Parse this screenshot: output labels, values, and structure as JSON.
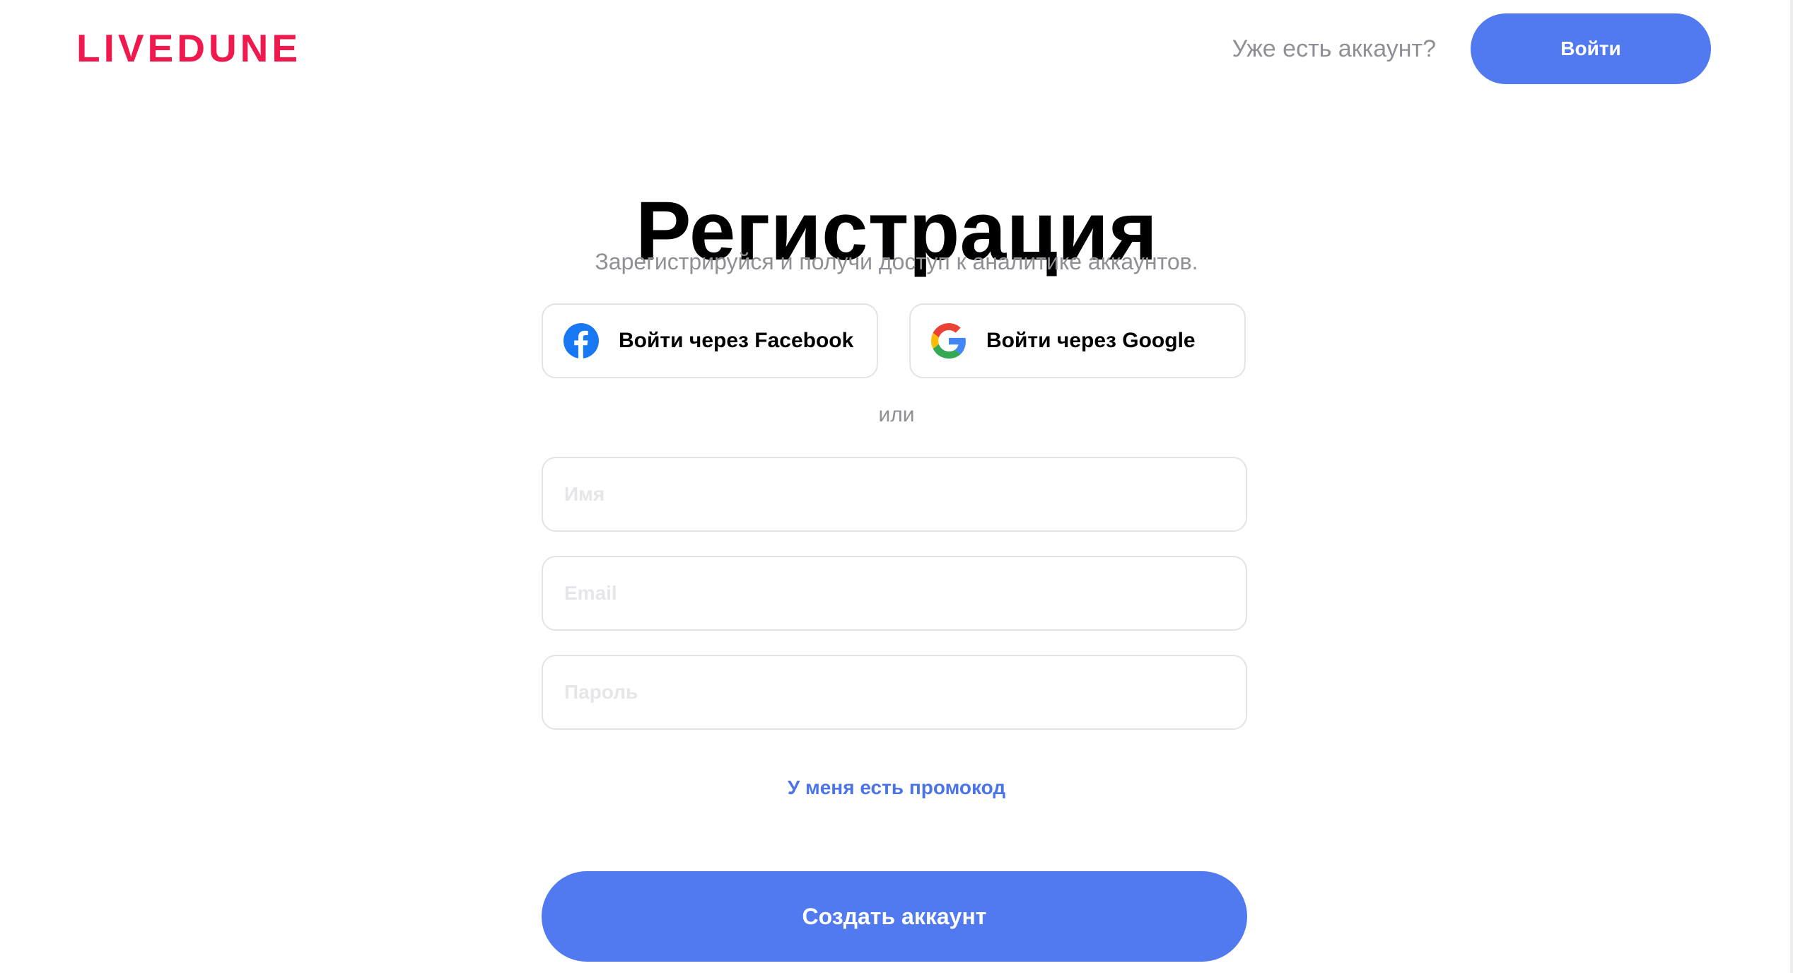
{
  "header": {
    "logo_text": "LIVEDUNE",
    "have_account_text": "Уже есть аккаунт?",
    "login_label": "Войти"
  },
  "main": {
    "title": "Регистрация",
    "subtitle": "Зарегистрируйся и получи доступ к аналитике аккаунтов.",
    "facebook_label": "Войти через Facebook",
    "google_label": "Войти через Google",
    "or_text": "или",
    "name_placeholder": "Имя",
    "email_placeholder": "Email",
    "password_placeholder": "Пароль",
    "name_value": "",
    "email_value": "",
    "password_value": "",
    "promo_label": "У меня есть промокод",
    "create_label": "Создать аккаунт"
  },
  "icons": {
    "facebook": "facebook-logo-icon",
    "google": "google-logo-icon"
  },
  "colors": {
    "brand": "#f0194e",
    "accent": "#5179f0",
    "link": "#4b74e8",
    "muted_text": "#8f8f96",
    "border": "#e3e3e8",
    "facebook_blue": "#1877f2"
  }
}
